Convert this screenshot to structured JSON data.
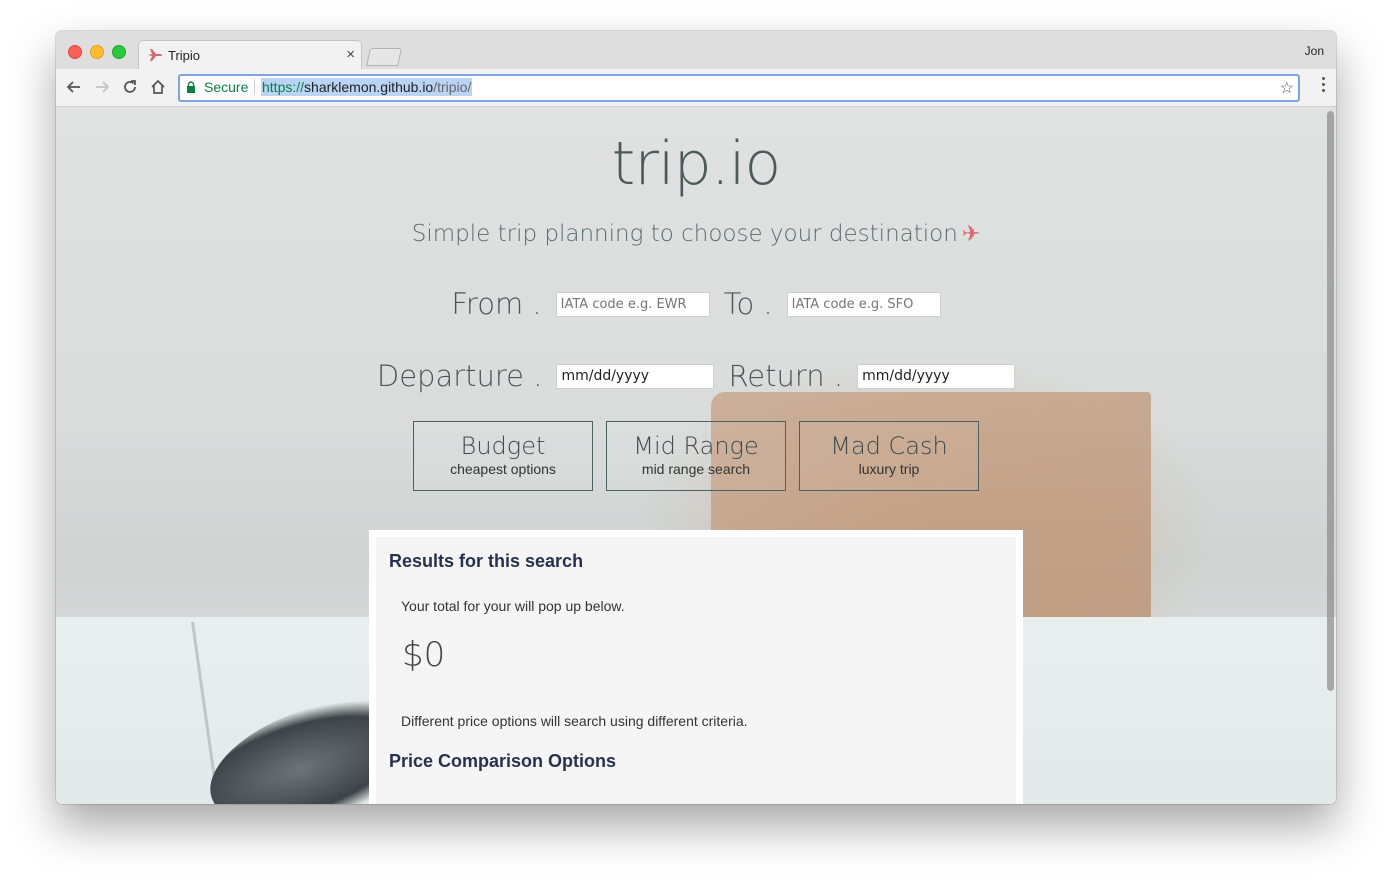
{
  "browser": {
    "tab_title": "Tripio",
    "tab_close": "×",
    "profile_name": "Jon",
    "secure_label": "Secure",
    "url_scheme": "https://",
    "url_host": "sharklemon.github.io",
    "url_path": "/tripio/",
    "bookmark_star": "☆"
  },
  "page": {
    "brand": "trip.io",
    "tagline": "Simple trip planning to choose your destination",
    "tagline_icon": "✈",
    "accent_color": "#d9696d",
    "from_label": "From .",
    "from_placeholder": "IATA code e.g. EWR",
    "to_label": "To .",
    "to_placeholder": "IATA code e.g. SFO",
    "departure_label": "Departure .",
    "departure_value": "mm/dd/yyyy",
    "return_label": "Return .",
    "return_value": "mm/dd/yyyy",
    "options": [
      {
        "title": "Budget",
        "subtitle": "cheapest options"
      },
      {
        "title": "Mid Range",
        "subtitle": "mid range search"
      },
      {
        "title": "Mad Cash",
        "subtitle": "luxury trip"
      }
    ],
    "results": {
      "title": "Results for this search",
      "note": "Your total for your will pop up below.",
      "total": "$0",
      "note2": "Different price options will search using different criteria.",
      "comparison_title": "Price Comparison Options"
    }
  }
}
